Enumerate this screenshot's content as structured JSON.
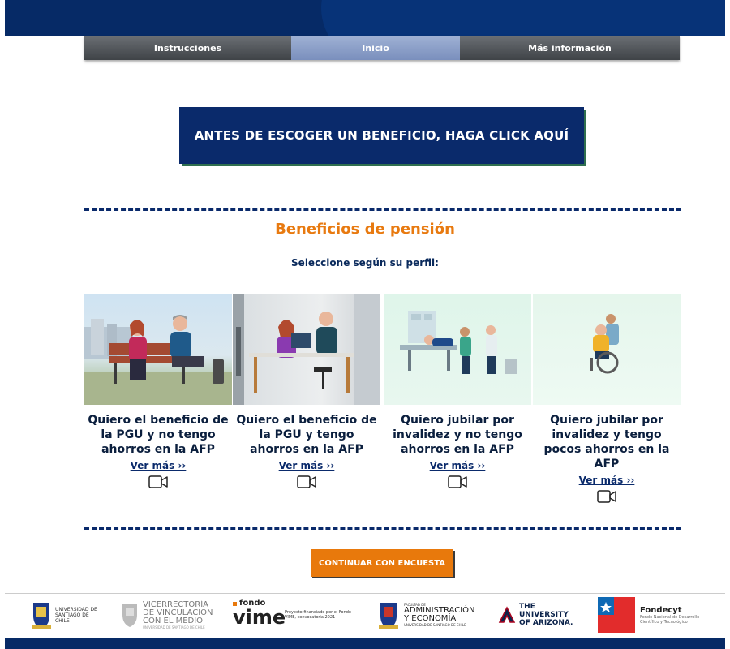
{
  "nav": {
    "items": [
      {
        "label": "Instrucciones",
        "active": false
      },
      {
        "label": "Inicio",
        "active": true
      },
      {
        "label": "Más información",
        "active": false
      }
    ]
  },
  "cta_top": "ANTES DE ESCOGER UN BENEFICIO, HAGA CLICK AQUÍ",
  "section": {
    "title": "Beneficios de pensión",
    "subtitle": "Seleccione según su perfil:"
  },
  "cards": [
    {
      "title": "Quiero el beneficio de la PGU y no tengo ahorros en la AFP",
      "link": "Ver más ››"
    },
    {
      "title": "Quiero el beneficio de la PGU y tengo ahorros en la AFP",
      "link": "Ver más ››"
    },
    {
      "title": "Quiero jubilar por invalidez y no tengo ahorros en la AFP",
      "link": "Ver más ››"
    },
    {
      "title": "Quiero jubilar por invalidez y tengo pocos ahorros en la AFP",
      "link": "Ver más ››"
    }
  ],
  "continue_button": "CONTINUAR CON ENCUESTA",
  "footer": {
    "usach": "UNIVERSIDAD DE SANTIAGO DE CHILE",
    "vice_1": "VICERRECTORÍA",
    "vice_2": "DE VINCULACIÓN",
    "vice_3": "CON EL MEDIO",
    "vice_4": "UNIVERSIDAD DE SANTIAGO DE CHILE",
    "vime_1": "fondo",
    "vime_2": "vime",
    "vime_note": "Proyecto financiado por el Fondo VIME, convocatoria 2021",
    "fae_1": "FACULTAD DE",
    "fae_2": "ADMINISTRACIÓN",
    "fae_3": "Y ECONOMÍA",
    "fae_4": "UNIVERSIDAD DE SANTIAGO DE CHILE",
    "ua": "THE UNIVERSITY OF ARIZONA.",
    "fondecyt_1": "Fondecyt",
    "fondecyt_2": "Fondo Nacional de Desarrollo Científico y Tecnológico"
  },
  "colors": {
    "navy": "#0a2a6b",
    "orange": "#e8790c",
    "banner": "#062a66"
  }
}
